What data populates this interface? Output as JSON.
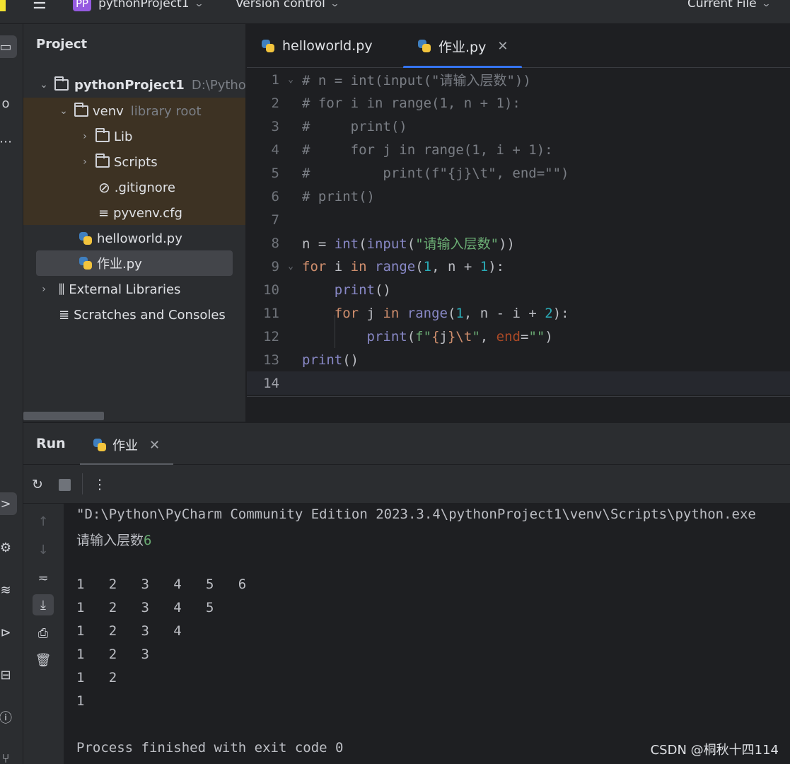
{
  "titlebar": {
    "project_badge": "PP",
    "project_name": "pythonProject1",
    "vcs": "Version control",
    "run_config": "Current File"
  },
  "project_panel": {
    "title": "Project",
    "root_name": "pythonProject1",
    "root_path": "D:\\Pytho",
    "venv": "venv",
    "venv_note": "library root",
    "lib": "Lib",
    "scripts": "Scripts",
    "gitignore": ".gitignore",
    "pyvenv": "pyvenv.cfg",
    "file1": "helloworld.py",
    "file2": "作业.py",
    "external": "External Libraries",
    "scratches": "Scratches and Consoles"
  },
  "tabs": [
    {
      "label": "helloworld.py"
    },
    {
      "label": "作业.py"
    }
  ],
  "editor": {
    "line_numbers": [
      "1",
      "2",
      "3",
      "4",
      "5",
      "6",
      "7",
      "8",
      "9",
      "10",
      "11",
      "12",
      "13",
      "14"
    ],
    "comment_lines": [
      "# n = int(input(\"请输入层数\"))",
      "# for i in range(1, n + 1):",
      "#     print()",
      "#     for j in range(1, i + 1):",
      "#         print(f\"{j}\\t\", end=\"\")",
      "# print()"
    ]
  },
  "run_panel": {
    "title": "Run",
    "tab_label": "作业"
  },
  "console": {
    "command": "\"D:\\Python\\PyCharm Community Edition 2023.3.4\\pythonProject1\\venv\\Scripts\\python.exe",
    "prompt": "请输入层数",
    "input_value": "6",
    "rows": [
      "1   2   3   4   5   6",
      "1   2   3   4   5",
      "1   2   3   4",
      "1   2   3",
      "1   2",
      "1"
    ],
    "exit": "Process finished with exit code 0"
  },
  "watermark": "CSDN @桐秋十四114"
}
